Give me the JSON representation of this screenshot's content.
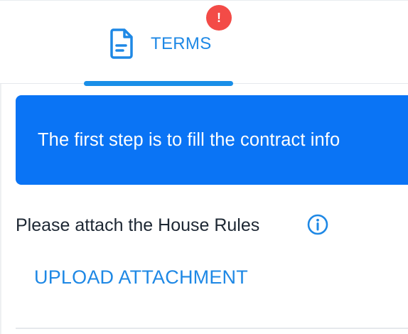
{
  "tabs": {
    "terms": {
      "label": "TERMS",
      "icon": "document-icon",
      "badge": "!",
      "active": true
    }
  },
  "banner": {
    "text": "The first step is to fill the contract info"
  },
  "attachment_section": {
    "heading": "Please attach the House Rules",
    "info_icon": "info-circle-icon",
    "upload_label": "UPLOAD ATTACHMENT"
  },
  "colors": {
    "accent": "#1E88E5",
    "banner_bg": "#0A74F5",
    "badge_bg": "#F34B47",
    "text_dark": "#1D2733"
  }
}
